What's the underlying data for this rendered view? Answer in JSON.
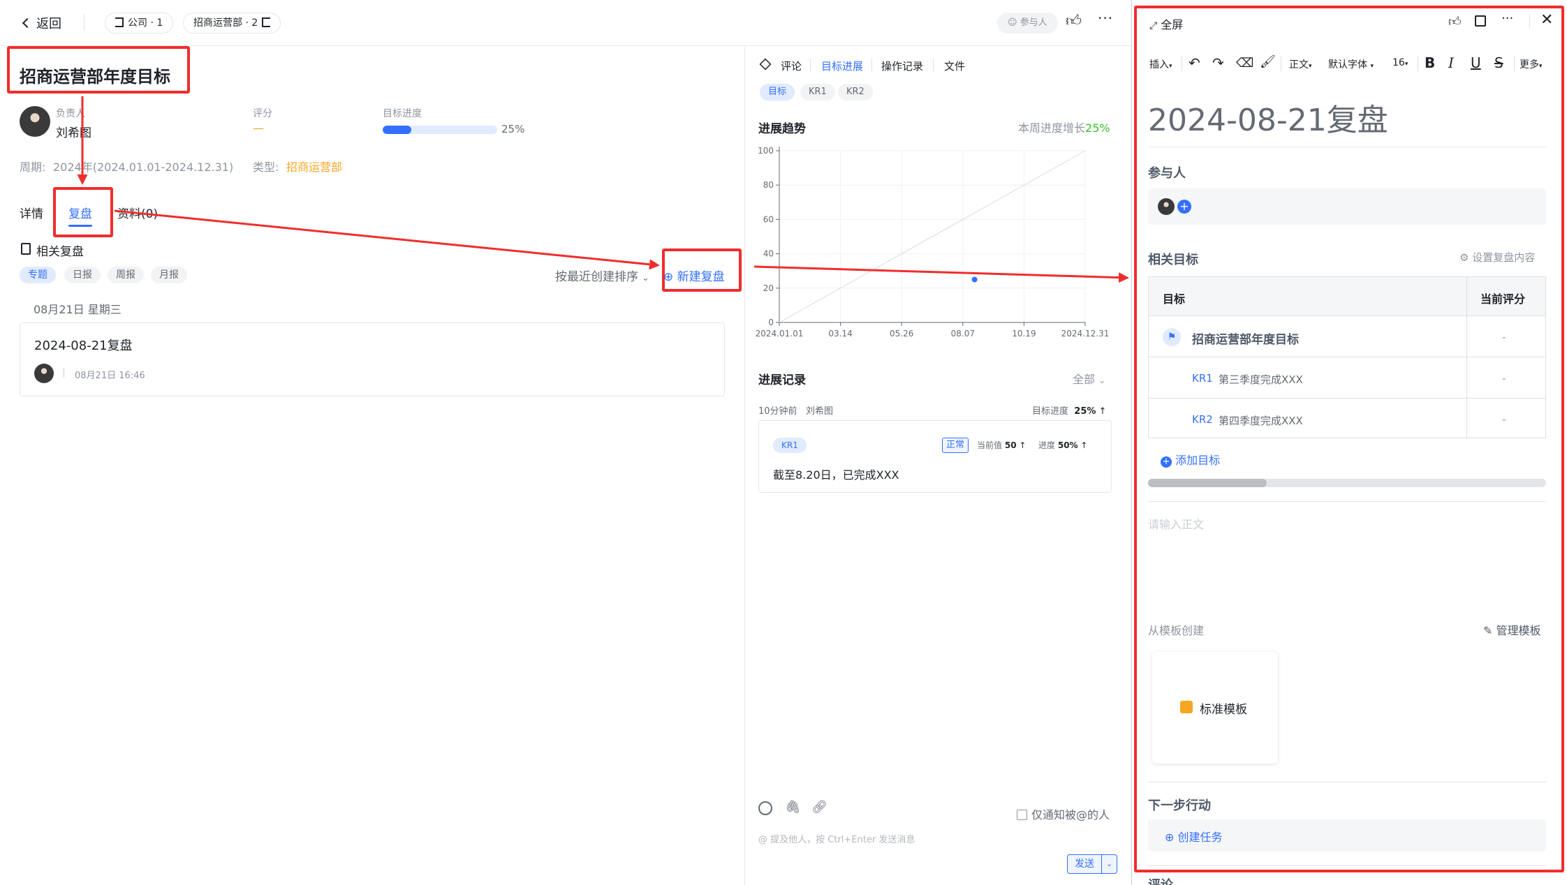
{
  "topbar": {
    "back_label": "返回",
    "crumb_company": "公司 · 1",
    "crumb_dept": "招商运营部 · 2",
    "participants_label": "参与人"
  },
  "goal": {
    "title": "招商运营部年度目标",
    "owner_label": "负责人",
    "owner_name": "刘希图",
    "score_label": "评分",
    "score_value": "—",
    "progress_label": "目标进度",
    "progress_value": "25%",
    "progress_fraction": 0.25,
    "period_label": "周期:",
    "period_value": "2024年(2024.01.01-2024.12.31)",
    "type_label": "类型:",
    "type_value": "招商运营部"
  },
  "left_tabs": [
    "详情",
    "复盘",
    "资料(0)"
  ],
  "review": {
    "section_title": "相关复盘",
    "filters": [
      "专题",
      "日报",
      "周报",
      "月报"
    ],
    "sort_label": "按最近创建排序",
    "new_button": "新建复盘",
    "date_group": "08月21日 星期三",
    "item_title": "2024-08-21复盘",
    "item_time": "08月21日 16:46"
  },
  "mid": {
    "tabs": [
      "评论",
      "目标进展",
      "操作记录",
      "文件"
    ],
    "subtabs": [
      "目标",
      "KR1",
      "KR2"
    ],
    "trend_title": "进展趋势",
    "week_growth_label": "本周进度增长",
    "week_growth_value": "25%",
    "records_title": "进展记录",
    "records_filter": "全部",
    "record_meta_time": "10分钟前",
    "record_meta_user": "刘希图",
    "record_progress_label": "目标进度",
    "record_progress_value": "25%",
    "record_kr": "KR1",
    "record_status": "正常",
    "record_current_label": "当前值",
    "record_current_value": "50",
    "record_pct_label": "进度",
    "record_pct_value": "50%",
    "record_text": "截至8.20日，已完成XXX",
    "notify_label": "仅通知被@的人",
    "input_placeholder": "@ 提及他人，按 Ctrl+Enter 发送消息",
    "send_label": "发送"
  },
  "chart_data": {
    "type": "scatter",
    "x_ticks": [
      "2024.01.01",
      "03.14",
      "05.26",
      "08.07",
      "10.19",
      "2024.12.31"
    ],
    "y_ticks": [
      0,
      20,
      40,
      60,
      80,
      100
    ],
    "ylim": [
      0,
      100
    ],
    "points": [
      {
        "x": "2024-08-21",
        "y": 25
      }
    ],
    "reference_line": {
      "from": [
        "2024.01.01",
        0
      ],
      "to": [
        "2024.12.31",
        100
      ]
    },
    "grid": true
  },
  "editor": {
    "fullscreen_label": "全屏",
    "toolbar": {
      "insert": "插入",
      "style": "正文",
      "font": "默认字体",
      "size": "16",
      "more": "更多"
    },
    "doc_title": "2024-08-21复盘",
    "participants_title": "参与人",
    "related_title": "相关目标",
    "settings_label": "设置复盘内容",
    "table_header_goal": "目标",
    "table_header_score": "当前评分",
    "rows": [
      {
        "tag": "",
        "name": "招商运营部年度目标",
        "score": "-"
      },
      {
        "tag": "KR1",
        "name": "第三季度完成XXX",
        "score": "-"
      },
      {
        "tag": "KR2",
        "name": "第四季度完成XXX",
        "score": "-"
      }
    ],
    "add_goal": "添加目标",
    "body_placeholder": "请输入正文",
    "template_title": "从模板创建",
    "manage_templates": "管理模板",
    "template_name": "标准模板",
    "next_title": "下一步行动",
    "create_task": "创建任务",
    "comments_title": "评论"
  },
  "colors": {
    "accent": "#3370ff",
    "annotation_red": "#f02d2d",
    "orange": "#f5a623",
    "green": "#34c724"
  }
}
